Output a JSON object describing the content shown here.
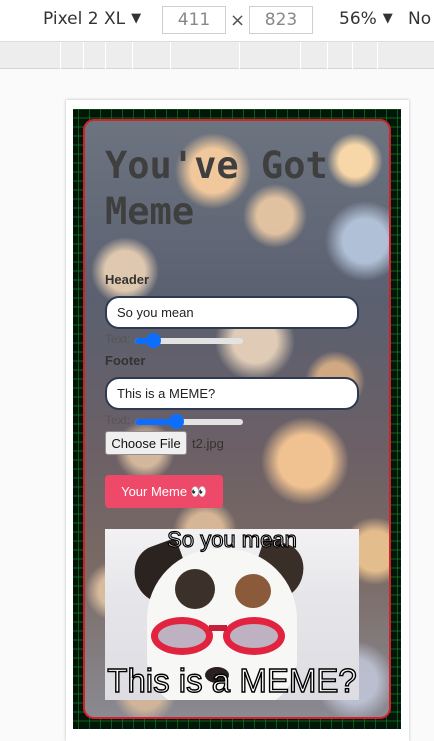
{
  "devtools": {
    "device": "Pixel 2 XL",
    "width": "411",
    "height": "823",
    "times": "×",
    "zoom": "56%",
    "throttle": "No",
    "caret": "▼"
  },
  "app": {
    "title": "You've Got Meme",
    "header_label": "Header",
    "header_value": "So you mean",
    "header_size_label": "Text:",
    "header_size": 0.16,
    "footer_label": "Footer",
    "footer_value": "This is a MEME?",
    "footer_size_label": "Text:",
    "footer_size": 0.38,
    "file_button": "Choose File",
    "file_name": "t2.jpg",
    "submit_label": "Your Meme 👀",
    "meme_top_text": "So you mean",
    "meme_bottom_text": "This is a MEME?"
  },
  "colors": {
    "card_border": "#d3202a",
    "submit_bg": "#ef4969",
    "slider": "#0d6efd",
    "input_border": "#2e3a52"
  }
}
